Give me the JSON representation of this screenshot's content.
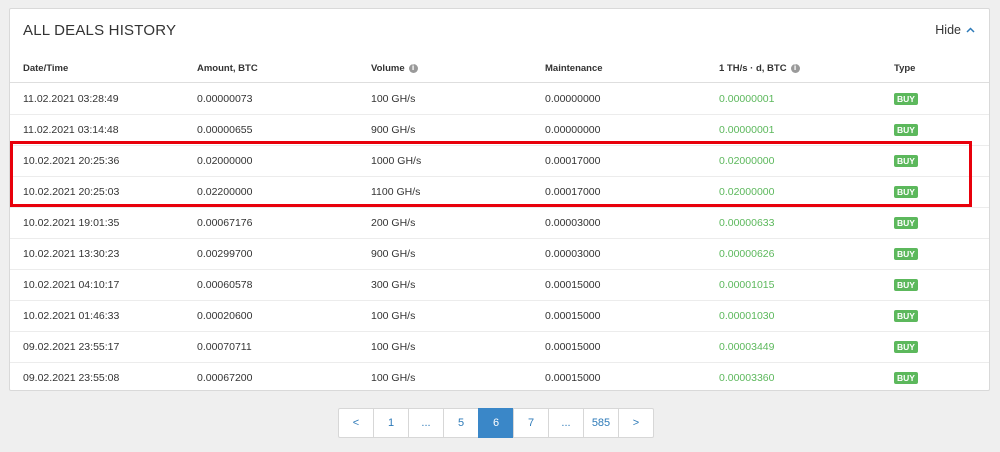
{
  "panel": {
    "title": "ALL DEALS HISTORY",
    "hide_label": "Hide",
    "hide_icon": "chevron-up-icon"
  },
  "columns": [
    "Date/Time",
    "Amount, BTC",
    "Volume",
    "Maintenance",
    "1 TH/s · d, BTC",
    "Type"
  ],
  "column_info_icons": {
    "Volume": "info-icon",
    "1 TH/s · d, BTC": "info-icon"
  },
  "rows": [
    {
      "datetime": "11.02.2021 03:28:49",
      "amount": "0.00000073",
      "volume": "100 GH/s",
      "maintenance": "0.00000000",
      "rate": "0.00000001",
      "type": "BUY"
    },
    {
      "datetime": "11.02.2021 03:14:48",
      "amount": "0.00000655",
      "volume": "900 GH/s",
      "maintenance": "0.00000000",
      "rate": "0.00000001",
      "type": "BUY"
    },
    {
      "datetime": "10.02.2021 20:25:36",
      "amount": "0.02000000",
      "volume": "1000 GH/s",
      "maintenance": "0.00017000",
      "rate": "0.02000000",
      "type": "BUY"
    },
    {
      "datetime": "10.02.2021 20:25:03",
      "amount": "0.02200000",
      "volume": "1100 GH/s",
      "maintenance": "0.00017000",
      "rate": "0.02000000",
      "type": "BUY"
    },
    {
      "datetime": "10.02.2021 19:01:35",
      "amount": "0.00067176",
      "volume": "200 GH/s",
      "maintenance": "0.00003000",
      "rate": "0.00000633",
      "type": "BUY"
    },
    {
      "datetime": "10.02.2021 13:30:23",
      "amount": "0.00299700",
      "volume": "900 GH/s",
      "maintenance": "0.00003000",
      "rate": "0.00000626",
      "type": "BUY"
    },
    {
      "datetime": "10.02.2021 04:10:17",
      "amount": "0.00060578",
      "volume": "300 GH/s",
      "maintenance": "0.00015000",
      "rate": "0.00001015",
      "type": "BUY"
    },
    {
      "datetime": "10.02.2021 01:46:33",
      "amount": "0.00020600",
      "volume": "100 GH/s",
      "maintenance": "0.00015000",
      "rate": "0.00001030",
      "type": "BUY"
    },
    {
      "datetime": "09.02.2021 23:55:17",
      "amount": "0.00070711",
      "volume": "100 GH/s",
      "maintenance": "0.00015000",
      "rate": "0.00003449",
      "type": "BUY"
    },
    {
      "datetime": "09.02.2021 23:55:08",
      "amount": "0.00067200",
      "volume": "100 GH/s",
      "maintenance": "0.00015000",
      "rate": "0.00003360",
      "type": "BUY"
    }
  ],
  "pagination": {
    "prev": "<",
    "pages": [
      "1",
      "...",
      "5",
      "6",
      "7",
      "...",
      "585"
    ],
    "active": "6",
    "next": ">"
  },
  "colors": {
    "positive_green": "#5cb85c",
    "active_page": "#3a87c8",
    "highlight_red": "#e8000b"
  }
}
